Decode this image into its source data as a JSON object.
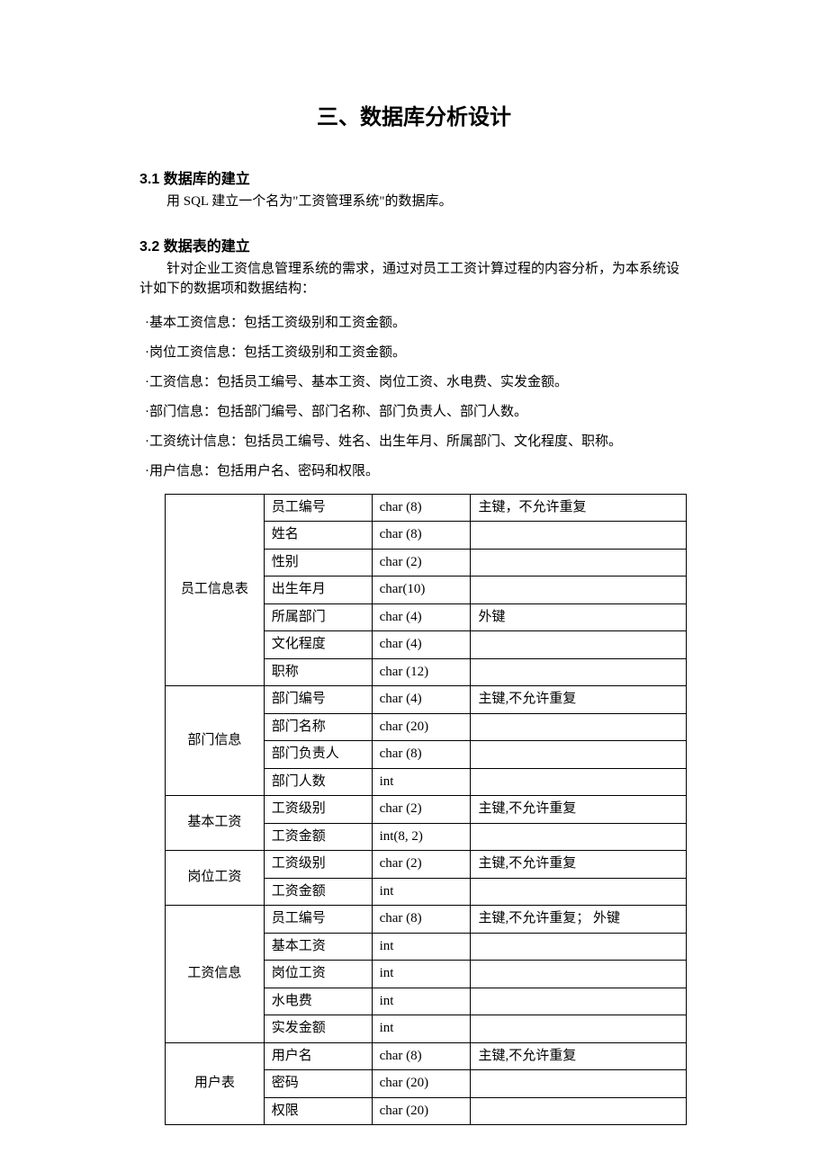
{
  "title": "三、数据库分析设计",
  "section31": {
    "heading": "3.1 数据库的建立",
    "text": "用 SQL 建立一个名为\"工资管理系统\"的数据库。"
  },
  "section32": {
    "heading": "3.2 数据表的建立",
    "text": "针对企业工资信息管理系统的需求，通过对员工工资计算过程的内容分析，为本系统设计如下的数据项和数据结构：",
    "bullets": [
      "·基本工资信息：包括工资级别和工资金额。",
      "·岗位工资信息：包括工资级别和工资金额。",
      "·工资信息：包括员工编号、基本工资、岗位工资、水电费、实发金额。",
      "·部门信息：包括部门编号、部门名称、部门负责人、部门人数。",
      "·工资统计信息：包括员工编号、姓名、出生年月、所属部门、文化程度、职称。",
      "·用户信息：包括用户名、密码和权限。"
    ]
  },
  "tables": [
    {
      "group": "员工信息表",
      "rows": [
        {
          "field": "员工编号",
          "type": "char (8)",
          "note": "主键，不允许重复"
        },
        {
          "field": "姓名",
          "type": "char (8)",
          "note": ""
        },
        {
          "field": "性别",
          "type": "char (2)",
          "note": ""
        },
        {
          "field": "出生年月",
          "type": "char(10)",
          "note": ""
        },
        {
          "field": "所属部门",
          "type": "char (4)",
          "note": "外键"
        },
        {
          "field": "文化程度",
          "type": "char (4)",
          "note": ""
        },
        {
          "field": "职称",
          "type": "char (12)",
          "note": ""
        }
      ]
    },
    {
      "group": "部门信息",
      "rows": [
        {
          "field": "部门编号",
          "type": "char (4)",
          "note": "主键,不允许重复"
        },
        {
          "field": "部门名称",
          "type": "char (20)",
          "note": ""
        },
        {
          "field": "部门负责人",
          "type": "char (8)",
          "note": ""
        },
        {
          "field": "部门人数",
          "type": "int",
          "note": ""
        }
      ]
    },
    {
      "group": "基本工资",
      "rows": [
        {
          "field": "工资级别",
          "type": "char (2)",
          "note": "主键,不允许重复"
        },
        {
          "field": "工资金额",
          "type": "int(8, 2)",
          "note": ""
        }
      ]
    },
    {
      "group": "岗位工资",
      "rows": [
        {
          "field": "工资级别",
          "type": "char (2)",
          "note": "主键,不允许重复"
        },
        {
          "field": "工资金额",
          "type": "int",
          "note": ""
        }
      ]
    },
    {
      "group": "工资信息",
      "rows": [
        {
          "field": "员工编号",
          "type": "char (8)",
          "note": "主键,不允许重复；  外键"
        },
        {
          "field": "基本工资",
          "type": "int",
          "note": ""
        },
        {
          "field": "岗位工资",
          "type": "int",
          "note": ""
        },
        {
          "field": "水电费",
          "type": "int",
          "note": ""
        },
        {
          "field": "实发金额",
          "type": "int",
          "note": ""
        }
      ]
    },
    {
      "group": "用户表",
      "rows": [
        {
          "field": "用户名",
          "type": "char (8)",
          "note": "主键,不允许重复"
        },
        {
          "field": "密码",
          "type": "char (20)",
          "note": ""
        },
        {
          "field": "权限",
          "type": "char (20)",
          "note": ""
        }
      ]
    }
  ]
}
